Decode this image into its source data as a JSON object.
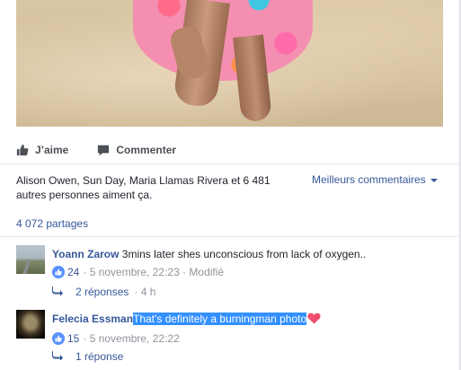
{
  "post": {
    "actions": {
      "like_label": "J’aime",
      "comment_label": "Commenter"
    },
    "likes_summary": "Alison Owen, Sun Day, Maria Llamas Rivera et 6 481 autres personnes aiment ça.",
    "sort_label": "Meilleurs commentaires",
    "shares_label": "4 072 partages"
  },
  "comments": [
    {
      "author": "Yoann Zarow",
      "text": "3mins later shes unconscious from lack of oxygen..",
      "like_count": "24",
      "meta_date": "· 5 novembre, 22:23 · Modifié",
      "replies_label": "2 réponses",
      "replies_time": "· 4 h"
    },
    {
      "author": "Felecia Essman",
      "text": "That's definitely a burningman photo",
      "like_count": "15",
      "meta_date": "· 5 novembre, 22:22",
      "replies_label": "1 réponse",
      "replies_time": ""
    }
  ],
  "colors": {
    "link": "#365899",
    "selection": "#3390ff",
    "like_blue": "#5890ff",
    "heart": "#f0506e"
  },
  "icons": [
    "thumbs-up-icon",
    "speech-bubble-icon",
    "caret-down-icon",
    "reply-arrow-icon",
    "like-badge-icon",
    "heart-icon"
  ]
}
